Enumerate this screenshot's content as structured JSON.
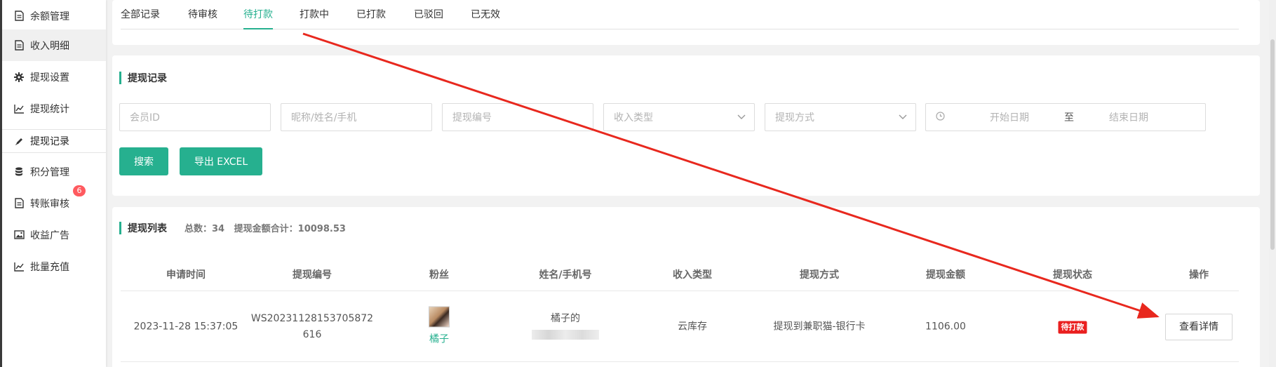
{
  "sidebar": {
    "items": [
      {
        "label": "余额管理",
        "icon": "document-icon"
      },
      {
        "label": "收入明细",
        "icon": "document-icon"
      },
      {
        "label": "提现设置",
        "icon": "gear-icon"
      },
      {
        "label": "提现统计",
        "icon": "line-chart-icon"
      },
      {
        "label": "提现记录",
        "icon": "pencil-icon"
      },
      {
        "label": "积分管理",
        "icon": "database-icon"
      },
      {
        "label": "转账审核",
        "icon": "document-icon",
        "badge": "6"
      },
      {
        "label": "收益广告",
        "icon": "image-icon"
      },
      {
        "label": "批量充值",
        "icon": "line-chart-icon"
      }
    ]
  },
  "tabs": [
    "全部记录",
    "待审核",
    "待打款",
    "打款中",
    "已打款",
    "已驳回",
    "已无效"
  ],
  "active_tab": "待打款",
  "filter": {
    "title": "提现记录",
    "member_id_placeholder": "会员ID",
    "name_placeholder": "昵称/姓名/手机",
    "withdraw_no_placeholder": "提现编号",
    "income_type_placeholder": "收入类型",
    "withdraw_method_placeholder": "提现方式",
    "start_date_placeholder": "开始日期",
    "date_separator": "至",
    "end_date_placeholder": "结束日期",
    "search_button": "搜索",
    "export_button": "导出 EXCEL"
  },
  "list": {
    "title": "提现列表",
    "total": "总数：34",
    "amount_total": "提现金额合计：10098.53",
    "columns": [
      "申请时间",
      "提现编号",
      "粉丝",
      "姓名/手机号",
      "收入类型",
      "提现方式",
      "提现金额",
      "提现状态",
      "操作"
    ],
    "rows": [
      {
        "time": "2023-11-28 15:37:05",
        "no_line1": "WS20231128153705872",
        "no_line2": "616",
        "fan": "橘子",
        "name": "橘子的",
        "income_type": "云库存",
        "method": "提现到兼职猫-银行卡",
        "amount": "1106.00",
        "status": "待打款",
        "action": "查看详情"
      }
    ]
  },
  "colors": {
    "accent": "#26b08f",
    "status_pending": "#ea1f1f",
    "annotation_arrow": "#e8281e",
    "badge": "#ff5a5f"
  }
}
